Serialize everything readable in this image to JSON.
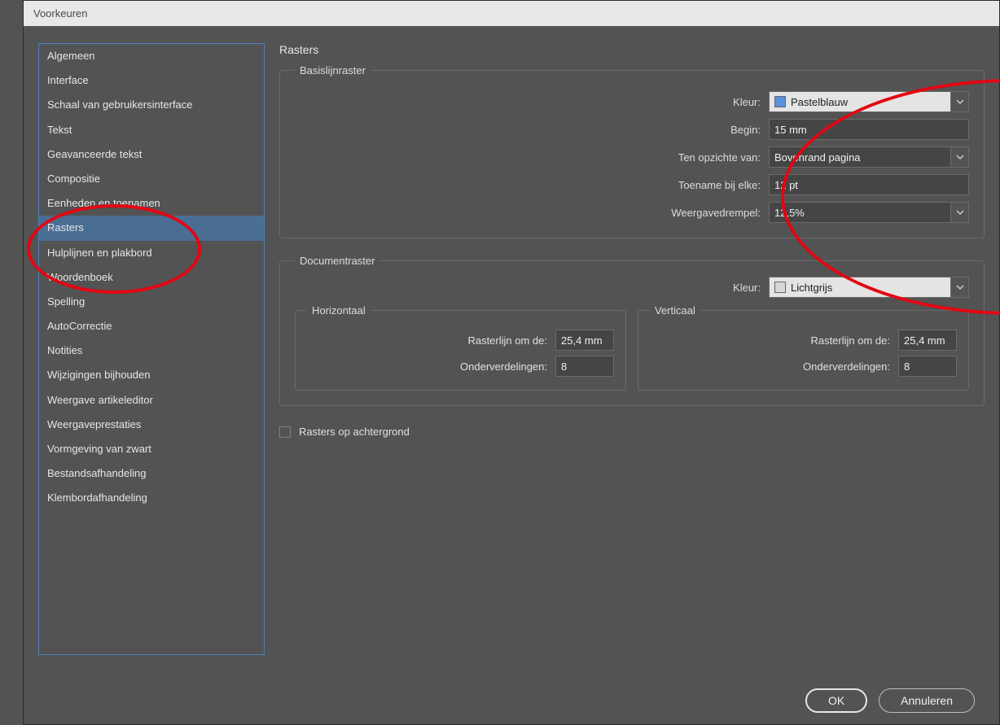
{
  "window": {
    "title": "Voorkeuren"
  },
  "sidebar": {
    "items": [
      {
        "label": "Algemeen"
      },
      {
        "label": "Interface"
      },
      {
        "label": "Schaal van gebruikersinterface"
      },
      {
        "label": "Tekst"
      },
      {
        "label": "Geavanceerde tekst"
      },
      {
        "label": "Compositie"
      },
      {
        "label": "Eenheden en toenamen"
      },
      {
        "label": "Rasters",
        "selected": true
      },
      {
        "label": "Hulplijnen en plakbord"
      },
      {
        "label": "Woordenboek"
      },
      {
        "label": "Spelling"
      },
      {
        "label": "AutoCorrectie"
      },
      {
        "label": "Notities"
      },
      {
        "label": "Wijzigingen bijhouden"
      },
      {
        "label": "Weergave artikeleditor"
      },
      {
        "label": "Weergaveprestaties"
      },
      {
        "label": "Vormgeving van zwart"
      },
      {
        "label": "Bestandsafhandeling"
      },
      {
        "label": "Klembordafhandeling"
      }
    ]
  },
  "panel": {
    "title": "Rasters",
    "baseline": {
      "legend": "Basislijnraster",
      "labels": {
        "kleur": "Kleur:",
        "begin": "Begin:",
        "relative": "Ten opzichte van:",
        "increment": "Toename bij elke:",
        "threshold": "Weergavedrempel:"
      },
      "values": {
        "kleur_name": "Pastelblauw",
        "kleur_hex": "#5b8fe0",
        "begin": "15 mm",
        "relative": "Bovenrand pagina",
        "increment": "12 pt",
        "threshold": "12,5%"
      }
    },
    "document": {
      "legend": "Documentraster",
      "kleur_label": "Kleur:",
      "kleur_name": "Lichtgrijs",
      "kleur_hex": "#d8d8d8",
      "horizontal": {
        "legend": "Horizontaal",
        "labels": {
          "gridline": "Rasterlijn om de:",
          "sub": "Onderverdelingen:"
        },
        "values": {
          "gridline": "25,4 mm",
          "sub": "8"
        }
      },
      "vertical": {
        "legend": "Verticaal",
        "labels": {
          "gridline": "Rasterlijn om de:",
          "sub": "Onderverdelingen:"
        },
        "values": {
          "gridline": "25,4 mm",
          "sub": "8"
        }
      }
    },
    "grids_back": {
      "label": "Rasters op achtergrond",
      "checked": false
    }
  },
  "buttons": {
    "ok": "OK",
    "cancel": "Annuleren"
  }
}
